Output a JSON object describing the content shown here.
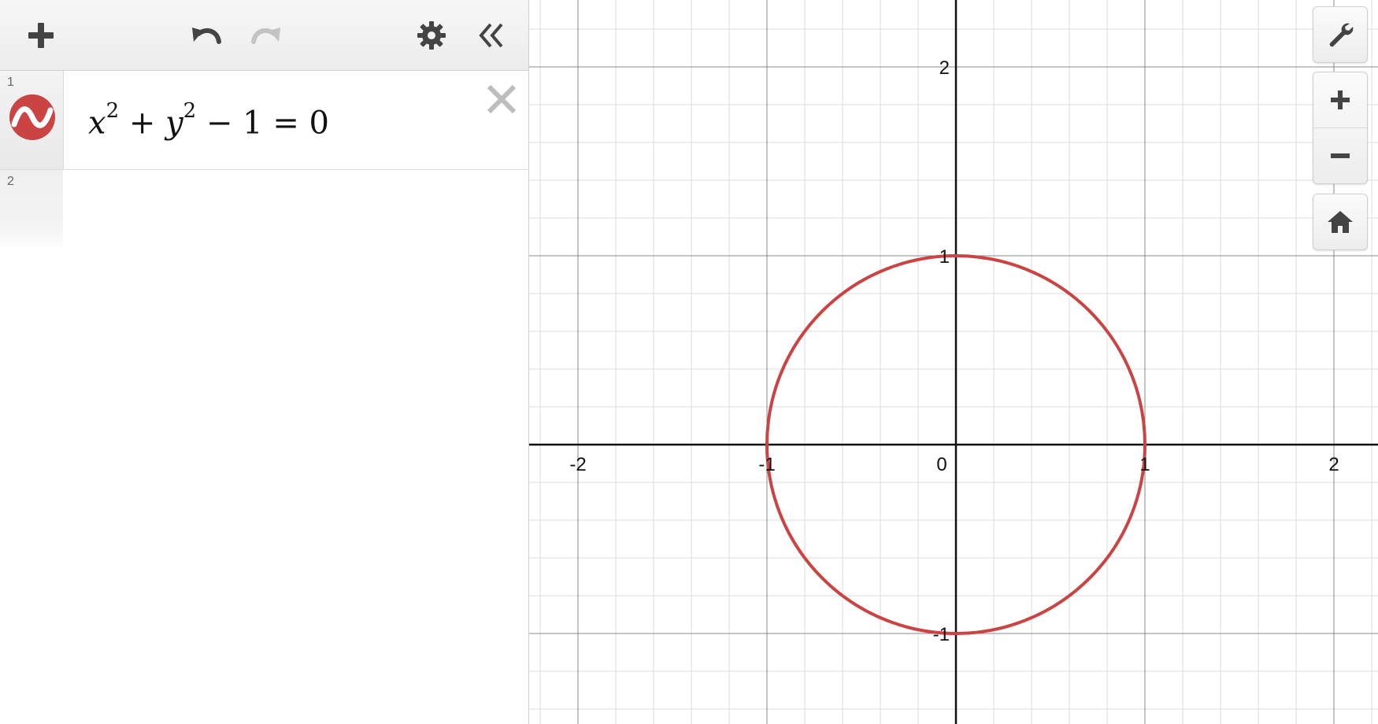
{
  "toolbar": {
    "add_icon": "plus-icon",
    "undo_icon": "undo-icon",
    "redo_icon": "redo-icon",
    "settings_icon": "gear-icon",
    "collapse_icon": "double-chevron-left-icon"
  },
  "expressions": [
    {
      "index": "1",
      "color": "#c94443",
      "icon": "graph-wave-icon",
      "latex_parts": {
        "x": "x",
        "x_exp": "2",
        "plus": " + ",
        "y": "y",
        "y_exp": "2",
        "rest": " − 1 = 0"
      }
    },
    {
      "index": "2"
    }
  ],
  "graph": {
    "x_ticks": [
      "-2",
      "-1",
      "0",
      "1",
      "2"
    ],
    "y_ticks": [
      "2",
      "1",
      "-1"
    ],
    "curve_color": "#c94443",
    "circle": {
      "center": [
        0,
        0
      ],
      "radius": 1
    }
  },
  "controls": {
    "wrench_icon": "wrench-icon",
    "zoom_in_icon": "plus-icon",
    "zoom_out_icon": "minus-icon",
    "home_icon": "home-icon"
  }
}
